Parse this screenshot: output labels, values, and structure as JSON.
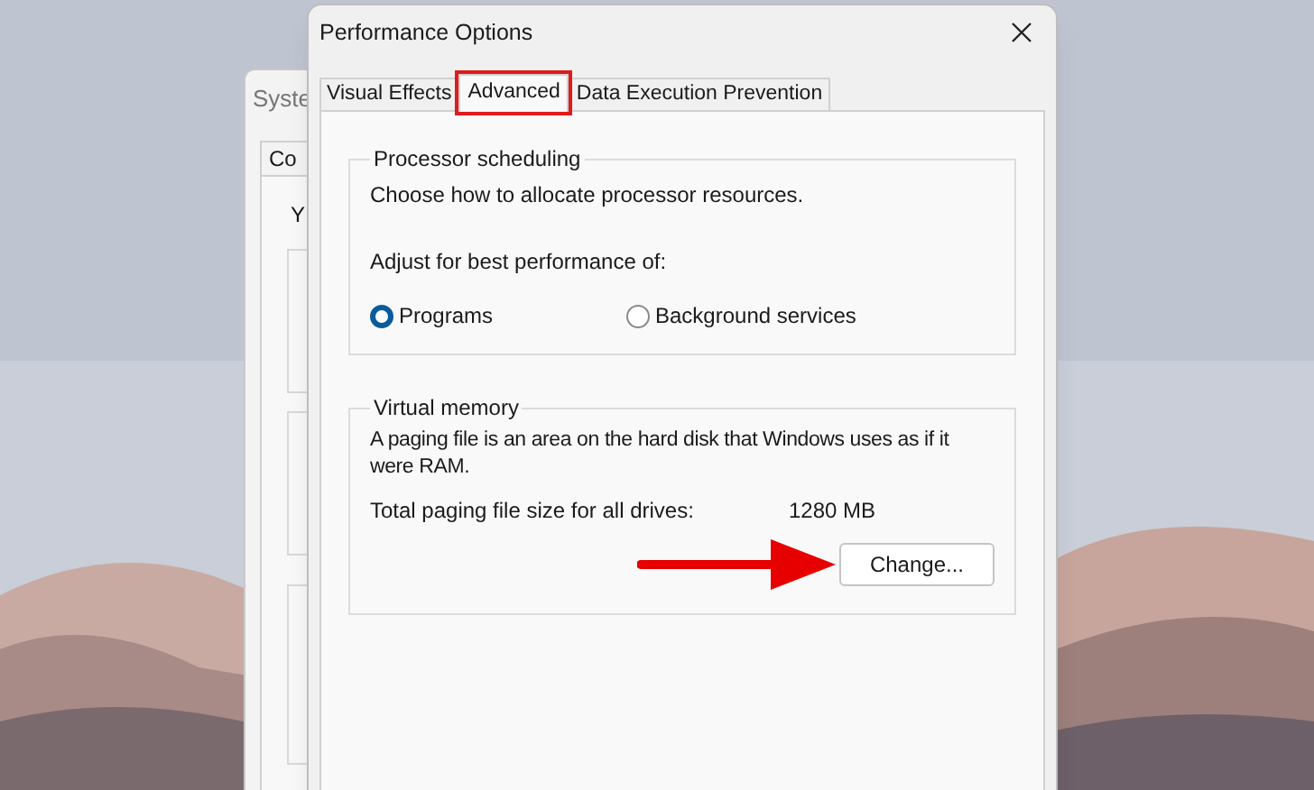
{
  "background_window": {
    "title": "Syste",
    "tab": "Co",
    "text": "Y"
  },
  "window": {
    "title": "Performance Options"
  },
  "tabs": [
    {
      "label": "Visual Effects",
      "selected": false
    },
    {
      "label": "Advanced",
      "selected": true
    },
    {
      "label": "Data Execution Prevention",
      "selected": false
    }
  ],
  "processor_scheduling": {
    "title": "Processor scheduling",
    "description": "Choose how to allocate processor resources.",
    "prompt": "Adjust for best performance of:",
    "options": [
      {
        "label": "Programs",
        "selected": true
      },
      {
        "label": "Background services",
        "selected": false
      }
    ]
  },
  "virtual_memory": {
    "title": "Virtual memory",
    "description": "A paging file is an area on the hard disk that Windows uses as if it were RAM.",
    "size_label": "Total paging file size for all drives:",
    "size_value": "1280 MB",
    "button": "Change..."
  }
}
